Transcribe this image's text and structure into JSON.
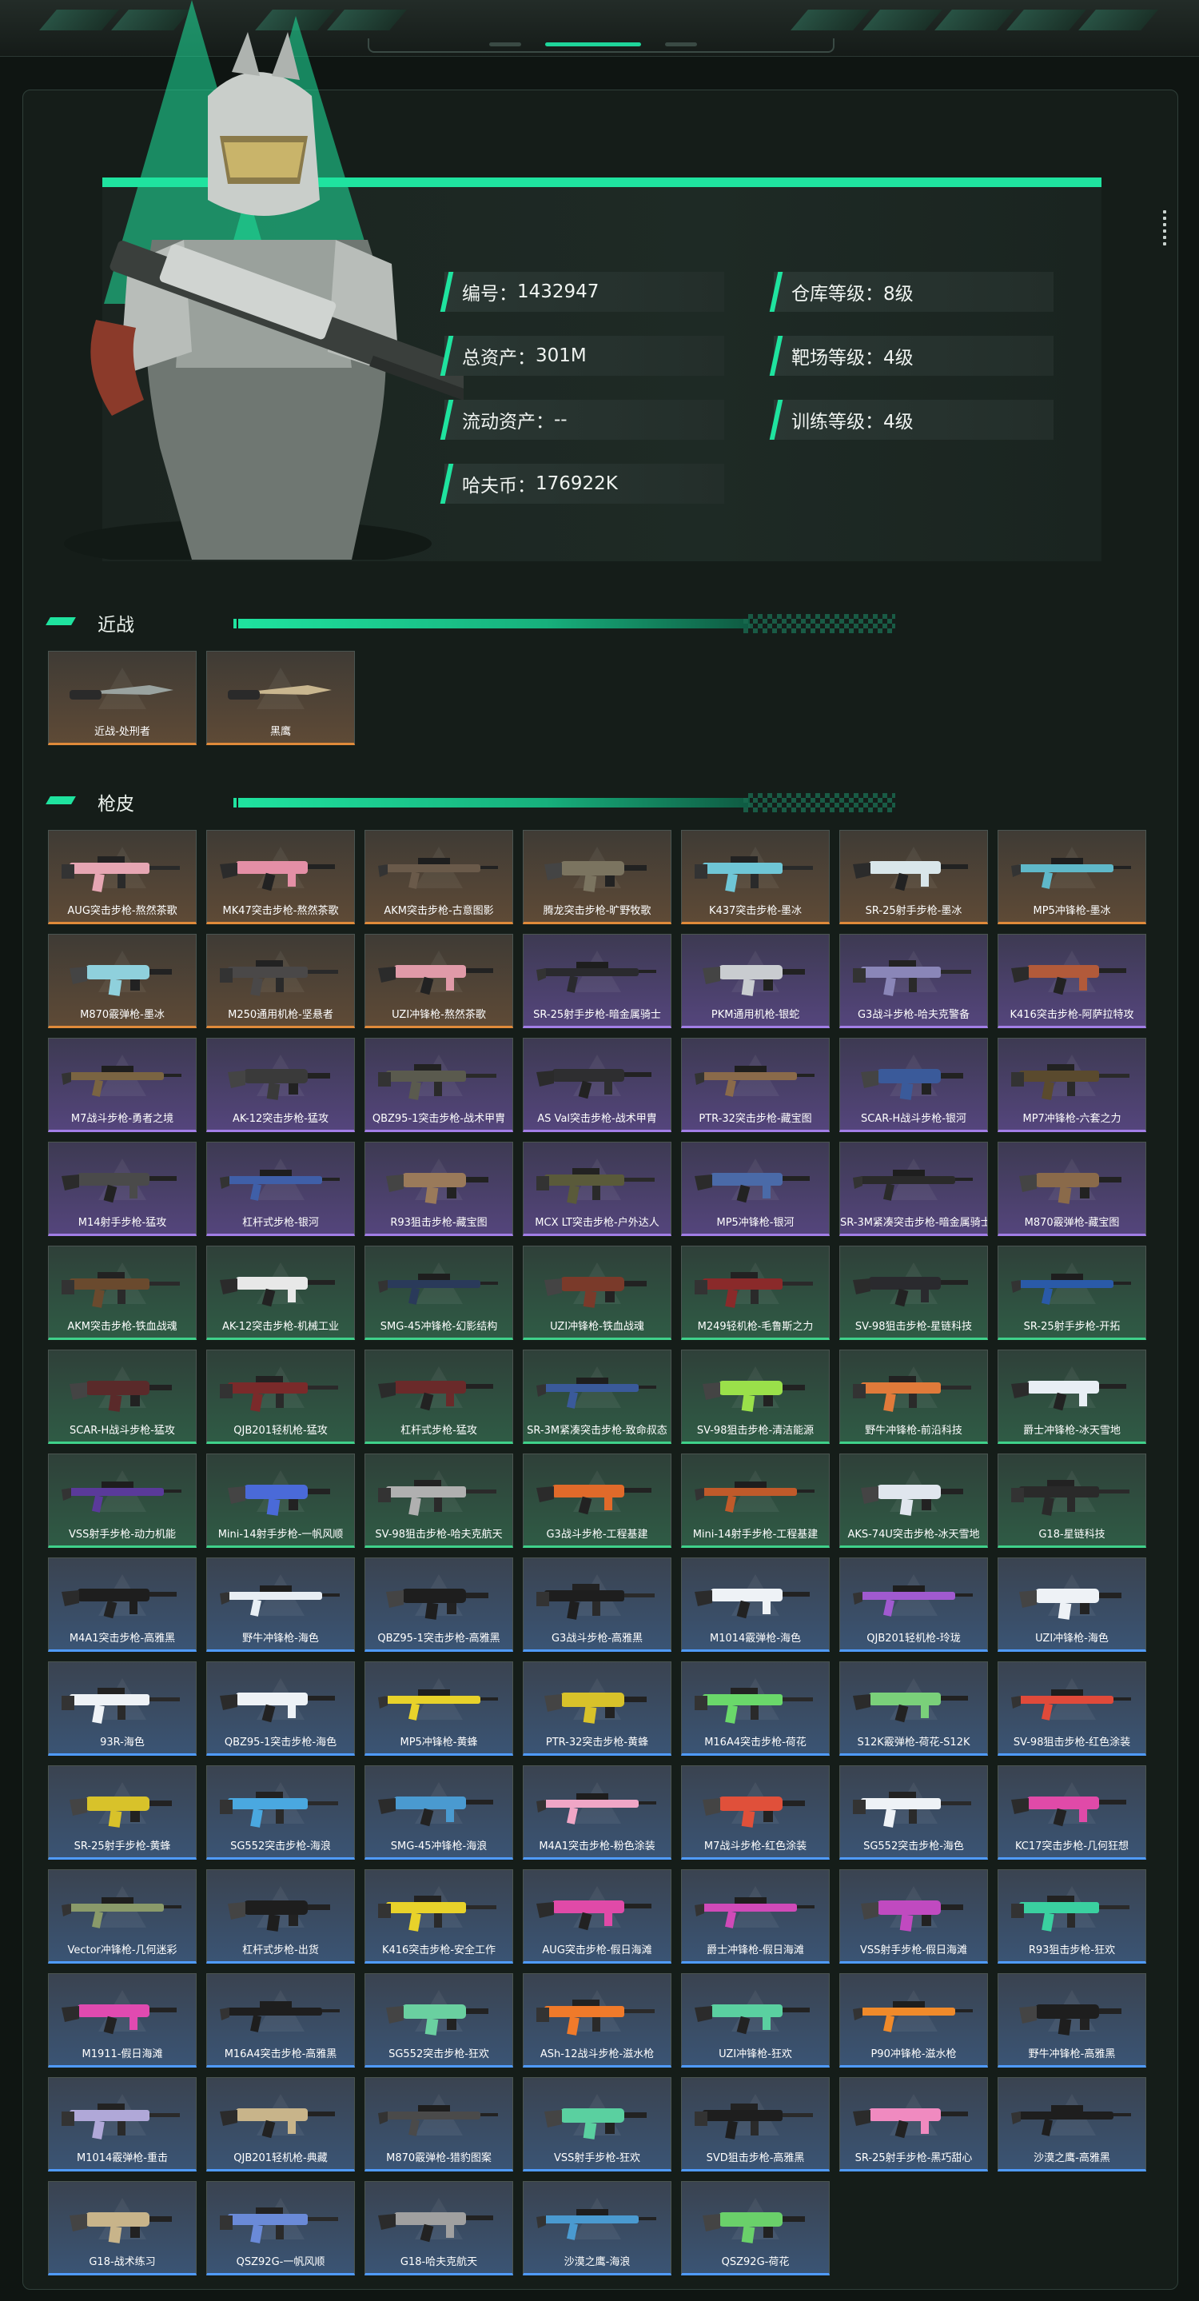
{
  "profile": {
    "stats": [
      {
        "label": "编号：",
        "value": "1432947"
      },
      {
        "label": "仓库等级：",
        "value": "8级"
      },
      {
        "label": "总资产：",
        "value": "301M"
      },
      {
        "label": "靶场等级：",
        "value": "4级"
      },
      {
        "label": "流动资产：",
        "value": "--"
      },
      {
        "label": "训练等级：",
        "value": "4级"
      },
      {
        "label": "哈夫币：",
        "value": "176922K"
      }
    ]
  },
  "melee": {
    "title": "近战",
    "items": [
      {
        "name": "近战-处刑者",
        "rarity": "gold",
        "color": "#9aa3a0"
      },
      {
        "name": "黑鹰",
        "rarity": "gold",
        "color": "#c9b68f"
      }
    ]
  },
  "skins": {
    "title": "枪皮",
    "items": [
      {
        "name": "AUG突击步枪-熬然茶歌",
        "rarity": "gold",
        "color": "#e6a6b3"
      },
      {
        "name": "MK47突击步枪-熬然茶歌",
        "rarity": "gold",
        "color": "#e48fa6"
      },
      {
        "name": "AKM突击步枪-古意图影",
        "rarity": "gold",
        "color": "#6a5a4a"
      },
      {
        "name": "腾龙突击步枪-旷野牧歌",
        "rarity": "gold",
        "color": "#7b7460"
      },
      {
        "name": "K437突击步枪-墨冰",
        "rarity": "gold",
        "color": "#6fc6d6"
      },
      {
        "name": "SR-25射手步枪-墨冰",
        "rarity": "gold",
        "color": "#d9e6ea"
      },
      {
        "name": "MP5冲锋枪-墨冰",
        "rarity": "gold",
        "color": "#5fb8c9"
      },
      {
        "name": "M870霰弹枪-墨冰",
        "rarity": "gold",
        "color": "#8fd0dc"
      },
      {
        "name": "M250通用机枪-坚悬者",
        "rarity": "gold",
        "color": "#4a4848"
      },
      {
        "name": "UZI冲锋枪-熬然茶歌",
        "rarity": "gold",
        "color": "#e09aa8"
      },
      {
        "name": "SR-25射手步枪-暗金属骑士",
        "rarity": "purple",
        "color": "#2a2a2e"
      },
      {
        "name": "PKM通用机枪-银蛇",
        "rarity": "purple",
        "color": "#c9ccd0"
      },
      {
        "name": "G3战斗步枪-哈夫克警备",
        "rarity": "purple",
        "color": "#8a86b8"
      },
      {
        "name": "K416突击步枪-阿萨拉特攻",
        "rarity": "purple",
        "color": "#b25a3a"
      },
      {
        "name": "M7战斗步枪-勇者之境",
        "rarity": "purple",
        "color": "#7a6442"
      },
      {
        "name": "AK-12突击步枪-猛攻",
        "rarity": "purple",
        "color": "#3a3a3a"
      },
      {
        "name": "QBZ95-1突击步枪-战术甲胄",
        "rarity": "purple",
        "color": "#5a5a4e"
      },
      {
        "name": "AS Val突击步枪-战术甲胄",
        "rarity": "purple",
        "color": "#2e2e30"
      },
      {
        "name": "PTR-32突击步枪-藏宝图",
        "rarity": "purple",
        "color": "#8a6a4a"
      },
      {
        "name": "SCAR-H战斗步枪-银河",
        "rarity": "purple",
        "color": "#3a5a9a"
      },
      {
        "name": "MP7冲锋枪-六套之力",
        "rarity": "purple",
        "color": "#5a4a2e"
      },
      {
        "name": "M14射手步枪-猛攻",
        "rarity": "purple",
        "color": "#4a4a4a"
      },
      {
        "name": "杠杆式步枪-银河",
        "rarity": "purple",
        "color": "#3f5fa8"
      },
      {
        "name": "R93狙击步枪-藏宝图",
        "rarity": "purple",
        "color": "#9a7a5a"
      },
      {
        "name": "MCX LT突击步枪-户外达人",
        "rarity": "purple",
        "color": "#5a5a3a"
      },
      {
        "name": "MP5冲锋枪-银河",
        "rarity": "purple",
        "color": "#4a6aa8"
      },
      {
        "name": "SR-3M紧凑突击步枪-暗金属骑士",
        "rarity": "purple",
        "color": "#2a2a2a"
      },
      {
        "name": "M870霰弹枪-藏宝图",
        "rarity": "purple",
        "color": "#8a6a4a"
      },
      {
        "name": "AKM突击步枪-铁血战魂",
        "rarity": "green",
        "color": "#6a4a2e"
      },
      {
        "name": "AK-12突击步枪-机械工业",
        "rarity": "green",
        "color": "#e8e8e8"
      },
      {
        "name": "SMG-45冲锋枪-幻影结构",
        "rarity": "green",
        "color": "#2a3a5a"
      },
      {
        "name": "UZI冲锋枪-铁血战魂",
        "rarity": "green",
        "color": "#7a3a2a"
      },
      {
        "name": "M249轻机枪-毛鲁斯之力",
        "rarity": "green",
        "color": "#8a2a2a"
      },
      {
        "name": "SV-98狙击步枪-星链科技",
        "rarity": "green",
        "color": "#2a2a2e"
      },
      {
        "name": "SR-25射手步枪-开拓",
        "rarity": "green",
        "color": "#2a5aa8"
      },
      {
        "name": "SCAR-H战斗步枪-猛攻",
        "rarity": "green",
        "color": "#5a2a2a"
      },
      {
        "name": "QJB201轻机枪-猛攻",
        "rarity": "green",
        "color": "#7a2a2a"
      },
      {
        "name": "杠杆式步枪-猛攻",
        "rarity": "green",
        "color": "#6a2a2a"
      },
      {
        "name": "SR-3M紧凑突击步枪-致命叔态",
        "rarity": "green",
        "color": "#3a5a9a"
      },
      {
        "name": "SV-98狙击步枪-清洁能源",
        "rarity": "green",
        "color": "#9ae04a"
      },
      {
        "name": "野牛冲锋枪-前沿科技",
        "rarity": "green",
        "color": "#e07a3a"
      },
      {
        "name": "爵士冲锋枪-冰天雪地",
        "rarity": "green",
        "color": "#e8eef4"
      },
      {
        "name": "VSS射手步枪-动力机能",
        "rarity": "green",
        "color": "#5a3a9a"
      },
      {
        "name": "Mini-14射手步枪-一帆风顺",
        "rarity": "green",
        "color": "#4a6ad8"
      },
      {
        "name": "SV-98狙击步枪-哈夫克航天",
        "rarity": "green",
        "color": "#b0b0b0"
      },
      {
        "name": "G3战斗步枪-工程基建",
        "rarity": "green",
        "color": "#e06a2a"
      },
      {
        "name": "Mini-14射手步枪-工程基建",
        "rarity": "green",
        "color": "#c05a2a"
      },
      {
        "name": "AKS-74U突击步枪-冰天雪地",
        "rarity": "green",
        "color": "#e0e6ee"
      },
      {
        "name": "G18-星链科技",
        "rarity": "green",
        "color": "#2a2a2a"
      },
      {
        "name": "M4A1突击步枪-高雅黑",
        "rarity": "blue",
        "color": "#1e1e1e"
      },
      {
        "name": "野牛冲锋枪-海色",
        "rarity": "blue",
        "color": "#e8eef4"
      },
      {
        "name": "QBZ95-1突击步枪-高雅黑",
        "rarity": "blue",
        "color": "#1e1e1e"
      },
      {
        "name": "G3战斗步枪-高雅黑",
        "rarity": "blue",
        "color": "#1e1e1e"
      },
      {
        "name": "M1014霰弹枪-海色",
        "rarity": "blue",
        "color": "#eef2f6"
      },
      {
        "name": "QJB201轻机枪-玲珑",
        "rarity": "blue",
        "color": "#a05ad0"
      },
      {
        "name": "UZI冲锋枪-海色",
        "rarity": "blue",
        "color": "#eef2f6"
      },
      {
        "name": "93R-海色",
        "rarity": "blue",
        "color": "#eef2f6"
      },
      {
        "name": "QBZ95-1突击步枪-海色",
        "rarity": "blue",
        "color": "#eef2f6"
      },
      {
        "name": "MP5冲锋枪-黄蜂",
        "rarity": "blue",
        "color": "#e8d22a"
      },
      {
        "name": "PTR-32突击步枪-黄蜂",
        "rarity": "blue",
        "color": "#d8c22a"
      },
      {
        "name": "M16A4突击步枪-荷花",
        "rarity": "blue",
        "color": "#6ad86a"
      },
      {
        "name": "S12K霰弹枪-荷花-S12K",
        "rarity": "blue",
        "color": "#7ad07a"
      },
      {
        "name": "SV-98狙击步枪-红色涂装",
        "rarity": "blue",
        "color": "#e04a3a"
      },
      {
        "name": "SR-25射手步枪-黄蜂",
        "rarity": "blue",
        "color": "#d8c22a"
      },
      {
        "name": "SG552突击步枪-海浪",
        "rarity": "blue",
        "color": "#4aa8e0"
      },
      {
        "name": "SMG-45冲锋枪-海浪",
        "rarity": "blue",
        "color": "#4a9ad0"
      },
      {
        "name": "M4A1突击步枪-粉色涂装",
        "rarity": "blue",
        "color": "#f0a6c6"
      },
      {
        "name": "M7战斗步枪-红色涂装",
        "rarity": "blue",
        "color": "#e0503a"
      },
      {
        "name": "SG552突击步枪-海色",
        "rarity": "blue",
        "color": "#eef2f6"
      },
      {
        "name": "KC17突击步枪-几何狂想",
        "rarity": "blue",
        "color": "#e04aa8"
      },
      {
        "name": "Vector冲锋枪-几何迷彩",
        "rarity": "blue",
        "color": "#8a9a6a"
      },
      {
        "name": "杠杆式步枪-出货",
        "rarity": "blue",
        "color": "#1e1e1e"
      },
      {
        "name": "K416突击步枪-安全工作",
        "rarity": "blue",
        "color": "#e8d22a"
      },
      {
        "name": "AUG突击步枪-假日海滩",
        "rarity": "blue",
        "color": "#e04aa8"
      },
      {
        "name": "爵士冲锋枪-假日海滩",
        "rarity": "blue",
        "color": "#d04ab8"
      },
      {
        "name": "VSS射手步枪-假日海滩",
        "rarity": "blue",
        "color": "#c04ac0"
      },
      {
        "name": "R93狙击步枪-狂欢",
        "rarity": "blue",
        "color": "#3ad0a0"
      },
      {
        "name": "M1911-假日海滩",
        "rarity": "blue",
        "color": "#e04ab0"
      },
      {
        "name": "M16A4突击步枪-高雅黑",
        "rarity": "blue",
        "color": "#1e1e1e"
      },
      {
        "name": "SG552突击步枪-狂欢",
        "rarity": "blue",
        "color": "#6ad0a0"
      },
      {
        "name": "ASh-12战斗步枪-滋水枪",
        "rarity": "blue",
        "color": "#f07a2a"
      },
      {
        "name": "UZI冲锋枪-狂欢",
        "rarity": "blue",
        "color": "#5ad0a0"
      },
      {
        "name": "P90冲锋枪-滋水枪",
        "rarity": "blue",
        "color": "#f08a2a"
      },
      {
        "name": "野牛冲锋枪-高雅黑",
        "rarity": "blue",
        "color": "#1e1e1e"
      },
      {
        "name": "M1014霰弹枪-重击",
        "rarity": "blue",
        "color": "#b0a8d8"
      },
      {
        "name": "QJB201轻机枪-典藏",
        "rarity": "blue",
        "color": "#c8b48a"
      },
      {
        "name": "M870霰弹枪-猎豹图案",
        "rarity": "blue",
        "color": "#4a4a4a"
      },
      {
        "name": "VSS射手步枪-狂欢",
        "rarity": "blue",
        "color": "#5ad0a0"
      },
      {
        "name": "SVD狙击步枪-高雅黑",
        "rarity": "blue",
        "color": "#1e1e1e"
      },
      {
        "name": "SR-25射手步枪-黑巧甜心",
        "rarity": "blue",
        "color": "#f08ac0"
      },
      {
        "name": "沙漠之鹰-高雅黑",
        "rarity": "blue",
        "color": "#1e1e1e"
      },
      {
        "name": "G18-战术练习",
        "rarity": "blue",
        "color": "#c8b48a"
      },
      {
        "name": "QSZ92G-一帆风顺",
        "rarity": "blue",
        "color": "#6a8ad8"
      },
      {
        "name": "G18-哈夫克航天",
        "rarity": "blue",
        "color": "#a0a0a0"
      },
      {
        "name": "沙漠之鹰-海浪",
        "rarity": "blue",
        "color": "#4a9ad0"
      },
      {
        "name": "QSZ92G-荷花",
        "rarity": "blue",
        "color": "#6ad06a"
      }
    ]
  }
}
